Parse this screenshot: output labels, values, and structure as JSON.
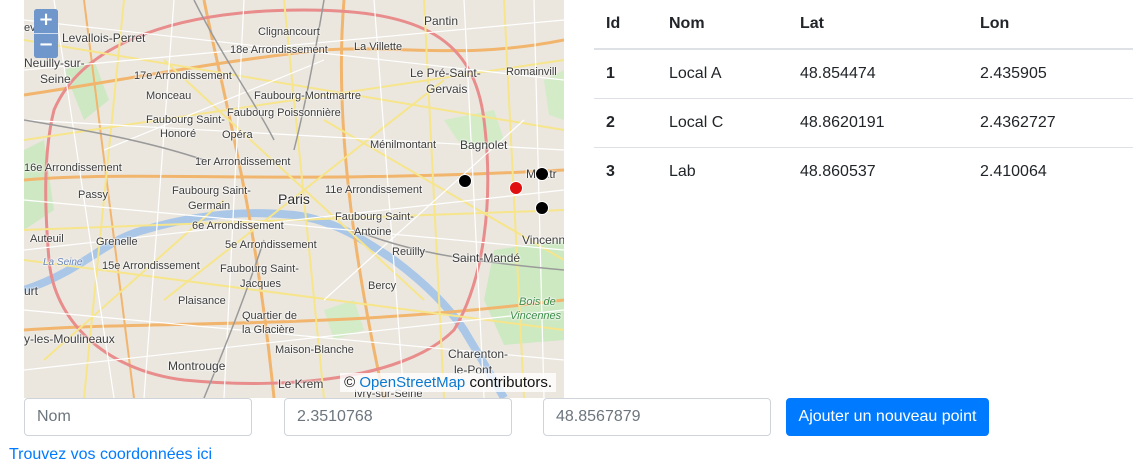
{
  "map": {
    "zoom_in": "+",
    "zoom_out": "−",
    "attribution_prefix": "©",
    "attribution_link": "OpenStreetMap",
    "attribution_suffix": "contributors.",
    "labels": {
      "pantin": "Pantin",
      "levallois": "Levallois-Perret",
      "levoie": "evoie",
      "clignancourt": "Clignancourt",
      "arr18": "18e Arrondissement",
      "lavillette": "La Villette",
      "neuilly1": "Neuilly-sur-",
      "neuilly2": "Seine",
      "arr17": "17e Arrondissement",
      "lepre1": "Le Pré-Saint-",
      "lepre2": "Gervais",
      "romainville": "Romainvill",
      "monceau": "Monceau",
      "faubourgmont": "Faubourg-Montmartre",
      "faubourgsh1": "Faubourg Saint-",
      "faubourgsh2": "Honoré",
      "faubourgpoiss": "Faubourg Poissonnière",
      "opera": "Opéra",
      "menilmontant": "Ménilmontant",
      "bagnolet": "Bagnolet",
      "arr1": "1er Arrondissement",
      "arr16": "16e Arrondissement",
      "montreuil": "Montr",
      "passy": "Passy",
      "faubourgsg1": "Faubourg Saint-",
      "faubourgsg2": "Germain",
      "paris": "Paris",
      "arr11": "11e Arrondissement",
      "faubourgsa1": "Faubourg Saint-",
      "faubourgsa2": "Antoine",
      "arr6": "6e Arrondissement",
      "auteuil": "Auteuil",
      "grenelle": "Grenelle",
      "arr5": "5e Arrondissement",
      "reuilly": "Reuilly",
      "vincennes": "Vincenn",
      "laseine": "La Seine",
      "arr15": "15e Arrondissement",
      "faubourgsj1": "Faubourg Saint-",
      "faubourgsj2": "Jacques",
      "saintmande": "Saint-Mandé",
      "urt": "urt",
      "bercy": "Bercy",
      "boisdev1": "Bois de",
      "boisdev2": "Vincennes",
      "plaisance": "Plaisance",
      "quartier1": "Quartier de",
      "quartier2": "la Glacière",
      "ylesmoul": "y-les-Moulineaux",
      "maisonblanche": "Maison-Blanche",
      "charenton1": "Charenton-",
      "charenton2": "le-Pont",
      "montrouge": "Montrouge",
      "lekrem": "Le Krem",
      "ivry": "Ivry-sur-Seine"
    }
  },
  "table": {
    "headers": [
      "Id",
      "Nom",
      "Lat",
      "Lon"
    ],
    "rows": [
      [
        "1",
        "Local A",
        "48.854474",
        "2.435905"
      ],
      [
        "2",
        "Local C",
        "48.8620191",
        "2.4362727"
      ],
      [
        "3",
        "Lab",
        "48.860537",
        "2.410064"
      ]
    ]
  },
  "form": {
    "name_placeholder": "Nom",
    "lon_placeholder": "2.3510768",
    "lat_placeholder": "48.8567879",
    "submit_label": "Ajouter un nouveau point"
  },
  "link_text": "Trouvez vos coordonnées ici",
  "colors": {
    "accent": "#007bff",
    "marker_default": "#000000",
    "marker_active": "#e01010"
  }
}
